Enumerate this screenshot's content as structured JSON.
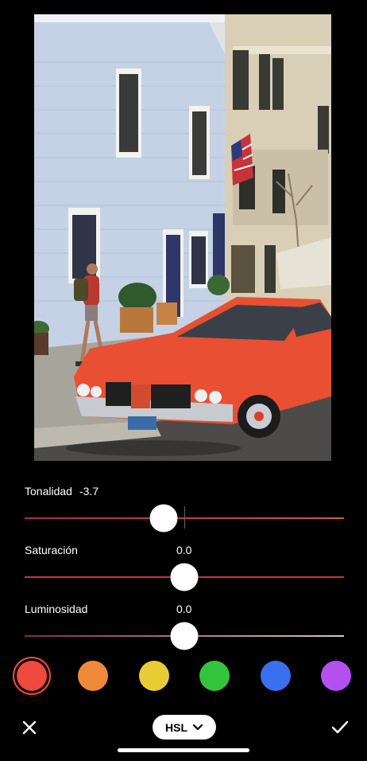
{
  "editor": {
    "sliders": [
      {
        "label": "Tonalidad",
        "value": "-3.7",
        "level": -0.019,
        "color": "#b8334f"
      },
      {
        "label": "Saturación",
        "value": "0.0",
        "level": 0.0,
        "color": "#c53256"
      },
      {
        "label": "Luminosidad",
        "value": "0.0",
        "level": 0.0,
        "color": "#d9c2cb"
      }
    ],
    "color_swatches": [
      {
        "name": "red",
        "color": "#ef4a3c",
        "selected": true
      },
      {
        "name": "orange",
        "color": "#ef8a3b",
        "selected": false
      },
      {
        "name": "yellow",
        "color": "#e8cc36",
        "selected": false
      },
      {
        "name": "green",
        "color": "#33c43d",
        "selected": false
      },
      {
        "name": "blue",
        "color": "#3a6ff0",
        "selected": false
      },
      {
        "name": "purple",
        "color": "#b44ff0",
        "selected": false
      }
    ],
    "mode_button": {
      "label": "HSL",
      "icon": "chevron-down-icon"
    },
    "cancel_icon": "close-icon",
    "confirm_icon": "checkmark-icon"
  }
}
